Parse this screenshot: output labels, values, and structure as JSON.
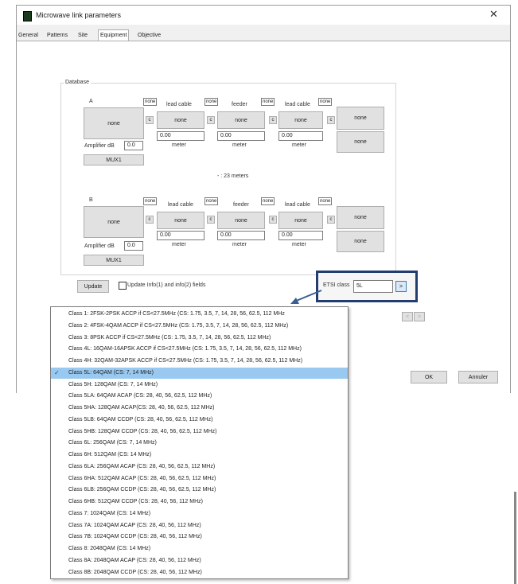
{
  "window": {
    "title": "Microwave link parameters",
    "close_label": "✕"
  },
  "tabs": [
    {
      "label": "General"
    },
    {
      "label": "Patterns"
    },
    {
      "label": "Site"
    },
    {
      "label": "Equipment"
    },
    {
      "label": "Objective"
    }
  ],
  "database": {
    "label": "Database",
    "distance_text": "- : 23 meters",
    "side_a": {
      "label": "A",
      "main_button": "none",
      "amplifier_label": "Amplifier dB",
      "amplifier_value": "0.0",
      "mux_label": "MUX1",
      "segments": [
        {
          "none_tag": "none",
          "c_label": "c",
          "title": "lead cable",
          "button": "none",
          "value": "0.00",
          "unit": "meter"
        },
        {
          "none_tag": "none",
          "c_label": "c",
          "title": "feeder",
          "button": "none",
          "value": "0.00",
          "unit": "meter"
        },
        {
          "none_tag": "none",
          "c_label": "c",
          "title": "lead cable",
          "button": "none",
          "value": "0.00",
          "unit": "meter"
        }
      ],
      "end_tag": "none",
      "right_buttons": [
        "none",
        "none"
      ]
    },
    "side_b": {
      "label": "B",
      "main_button": "none",
      "amplifier_label": "Amplifier dB",
      "amplifier_value": "0.0",
      "mux_label": "MUX1",
      "segments": [
        {
          "none_tag": "none",
          "c_label": "c",
          "title": "lead cable",
          "button": "none",
          "value": "0.00",
          "unit": "meter"
        },
        {
          "none_tag": "none",
          "c_label": "c",
          "title": "feeder",
          "button": "none",
          "value": "0.00",
          "unit": "meter"
        },
        {
          "none_tag": "none",
          "c_label": "c",
          "title": "lead cable",
          "button": "none",
          "value": "0.00",
          "unit": "meter"
        }
      ],
      "end_tag": "none",
      "right_buttons": [
        "none",
        "none"
      ]
    }
  },
  "update": {
    "button_label": "Update",
    "checkbox_label": "Update Info(1) and info(2) fields"
  },
  "etsi": {
    "label": "ETSI class",
    "value": "5L",
    "go_label": ">"
  },
  "nav": {
    "prev": "<",
    "next": ">"
  },
  "footer": {
    "ok": "OK",
    "cancel": "Annuler"
  },
  "dropdown": {
    "selected_index": 5,
    "check_mark": "✓",
    "items": [
      "Class 1: 2FSK-2PSK ACCP if CS<27.5MHz (CS: 1.75, 3.5, 7, 14, 28, 56, 62.5, 112 MHz",
      "Class 2: 4FSK-4QAM ACCP if CS<27.5MHz (CS: 1.75, 3.5, 7, 14, 28, 56, 62.5, 112 MHz)",
      "Class 3: 8PSK ACCP if CS<27.5MHz (CS: 1.75, 3.5, 7, 14, 28, 56, 62.5, 112 MHz)",
      "Class 4L: 16QAM-16APSK ACCP if CS<27.5MHz (CS: 1.75, 3.5, 7, 14, 28, 56, 62.5, 112 MHz)",
      "Class 4H: 32QAM-32APSK ACCP if CS<27.5MHz (CS: 1.75, 3.5, 7, 14, 28, 56, 62.5, 112 MHz)",
      "Class 5L: 64QAM (CS: 7, 14 MHz)",
      "Class 5H: 128QAM (CS: 7, 14 MHz)",
      "Class 5LA: 64QAM ACAP (CS: 28, 40, 56, 62.5, 112 MHz)",
      "Class 5HA: 128QAM ACAP(CS: 28, 40, 56, 62.5, 112 MHz)",
      "Class 5LB: 64QAM CCDP (CS: 28, 40, 56, 62.5, 112 MHz)",
      "Class 5HB: 128QAM CCDP (CS: 28, 40, 56, 62.5, 112 MHz)",
      "Class 6L: 256QAM (CS: 7, 14 MHz)",
      "Class 6H: 512QAM (CS: 14 MHz)",
      "Class 6LA: 256QAM ACAP (CS: 28, 40, 56, 62.5, 112 MHz)",
      "Class 6HA: 512QAM ACAP (CS: 28, 40, 56, 62.5, 112 MHz)",
      "Class 6LB: 256QAM CCDP (CS: 28, 40, 56, 62.5, 112 MHz)",
      "Class 6HB: 512QAM CCDP (CS: 28, 40, 56, 112 MHz)",
      "Class 7: 1024QAM (CS: 14 MHz)",
      "Class 7A: 1024QAM ACAP (CS: 28, 40, 56, 112 MHz)",
      "Class 7B: 1024QAM CCDP (CS: 28, 40, 56, 112 MHz)",
      "Class 8: 2048QAM (CS: 14 MHz)",
      "Class 8A: 2048QAM ACAP (CS: 28, 40, 56, 112 MHz)",
      "Class 8B: 2048QAM CCDP (CS: 28, 40, 56, 112 MHz)"
    ]
  }
}
